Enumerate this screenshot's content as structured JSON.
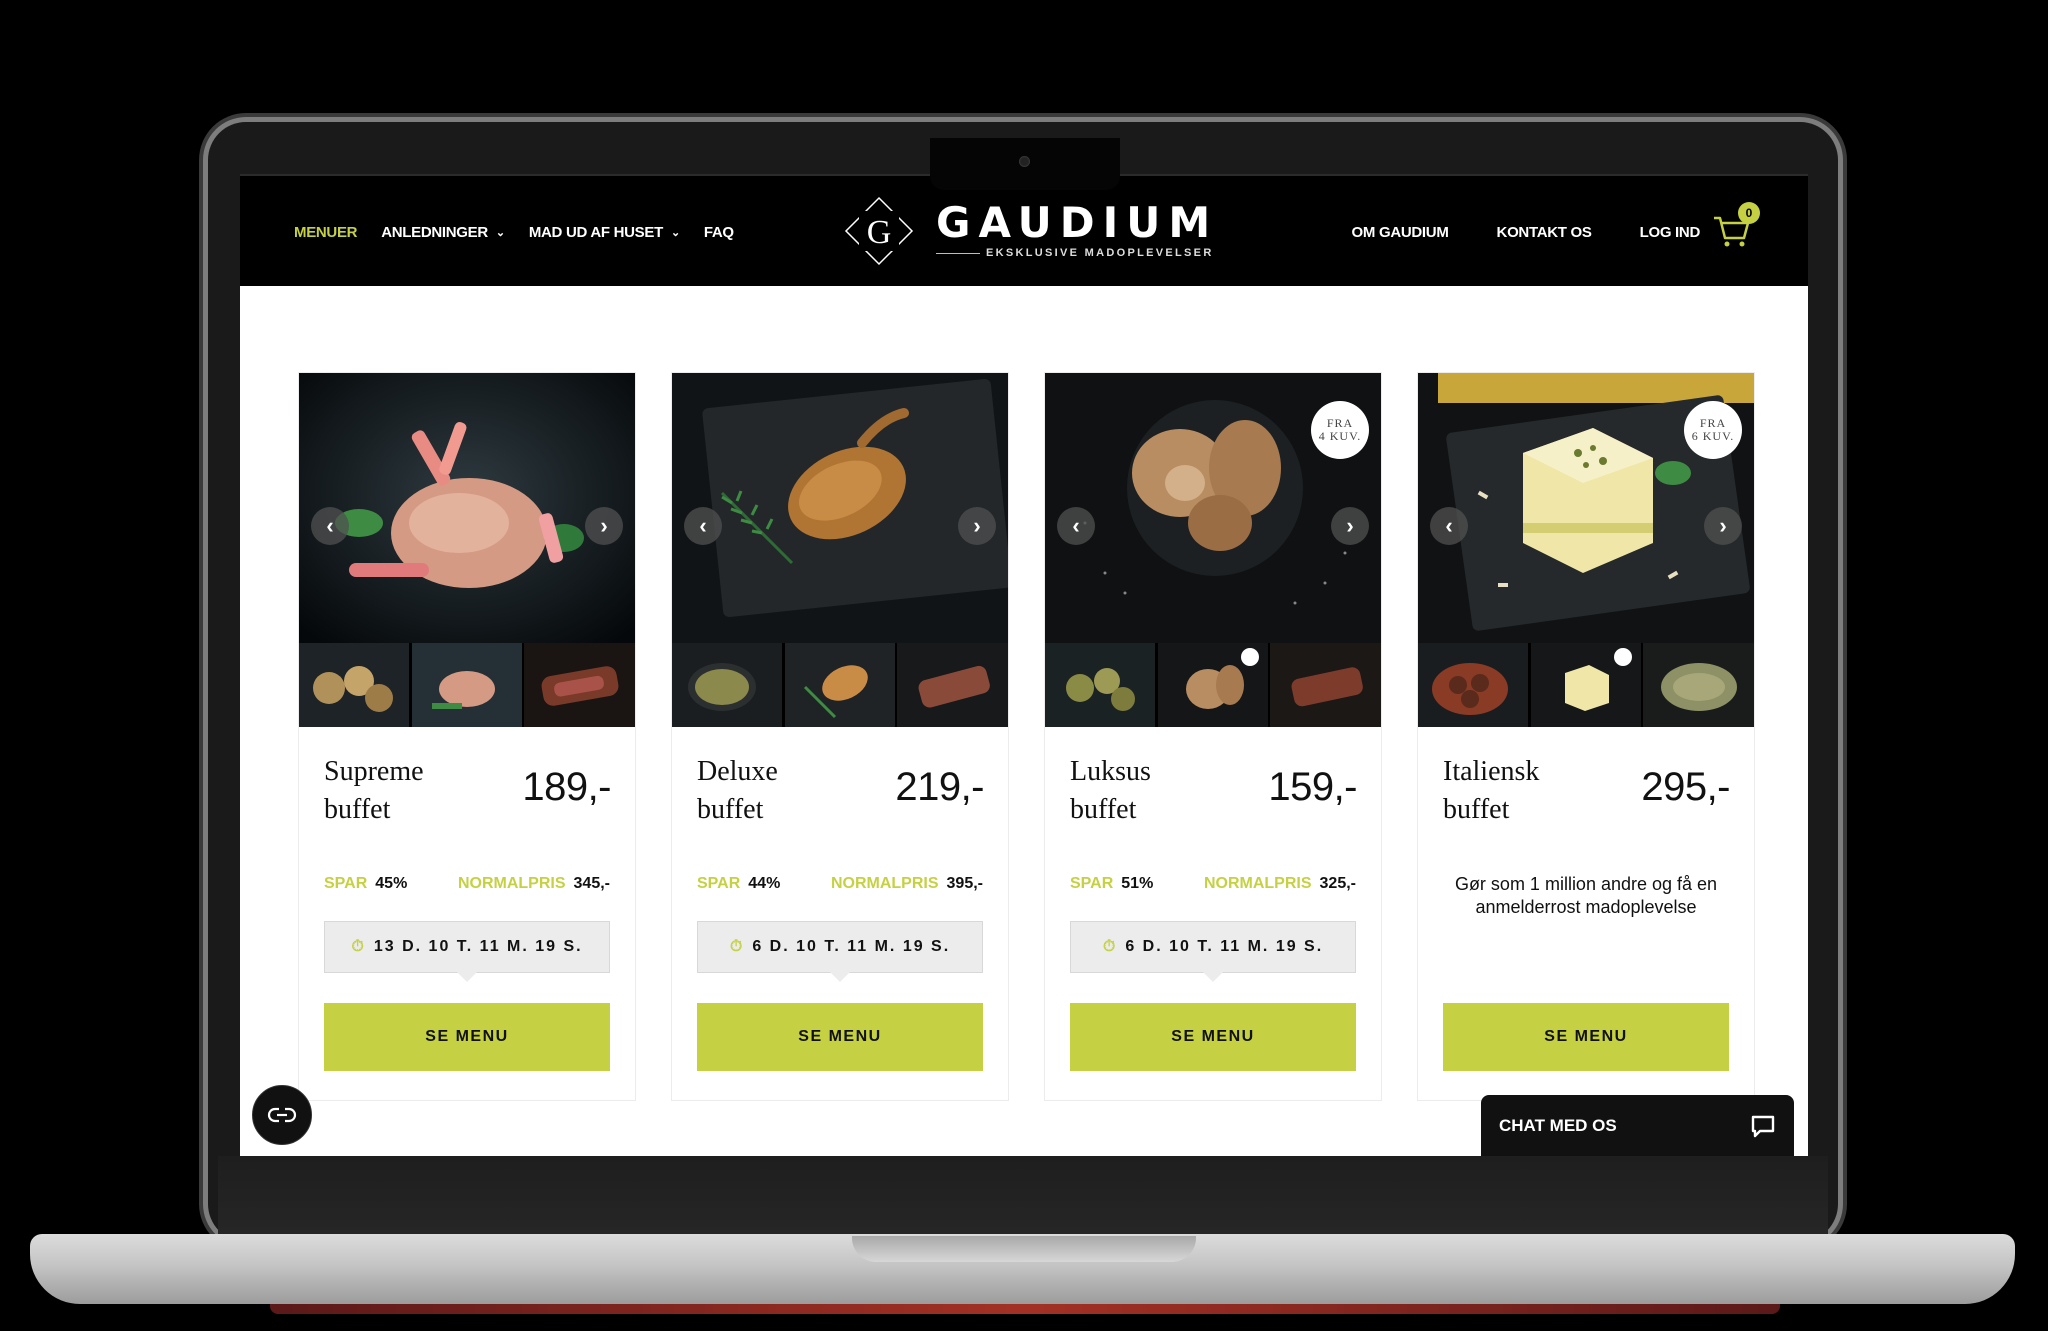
{
  "header": {
    "nav_left": [
      {
        "label": "MENUER",
        "active": true,
        "has_dropdown": false
      },
      {
        "label": "ANLEDNINGER",
        "active": false,
        "has_dropdown": true
      },
      {
        "label": "MAD UD AF HUSET",
        "active": false,
        "has_dropdown": true
      },
      {
        "label": "FAQ",
        "active": false,
        "has_dropdown": false
      }
    ],
    "logo": {
      "mark": "G",
      "name": "GAUDIUM",
      "tagline": "EKSKLUSIVE MADOPLEVELSER"
    },
    "nav_right": [
      {
        "label": "OM GAUDIUM"
      },
      {
        "label": "KONTAKT OS"
      },
      {
        "label": "LOG IND"
      }
    ],
    "cart_count": "0"
  },
  "cards": [
    {
      "name": "Supreme buffet",
      "price": "189,-",
      "save_label": "SPAR",
      "save_value": "45%",
      "normal_label": "NORMALPRIS",
      "normal_value": "345,-",
      "timer": "13 D. 10 T. 11 M. 19 S.",
      "cta": "SE MENU"
    },
    {
      "name": "Deluxe buffet",
      "price": "219,-",
      "save_label": "SPAR",
      "save_value": "44%",
      "normal_label": "NORMALPRIS",
      "normal_value": "395,-",
      "timer": "6 D. 10 T. 11 M. 19 S.",
      "cta": "SE MENU"
    },
    {
      "name": "Luksus buffet",
      "price": "159,-",
      "badge_line1": "FRA",
      "badge_line2": "4 KUV.",
      "save_label": "SPAR",
      "save_value": "51%",
      "normal_label": "NORMALPRIS",
      "normal_value": "325,-",
      "timer": "6 D. 10 T. 11 M. 19 S.",
      "cta": "SE MENU"
    },
    {
      "name": "Italiensk buffet",
      "price": "295,-",
      "badge_line1": "FRA",
      "badge_line2": "6 KUV.",
      "promo": "Gør som 1 million andre og få en anmelderrost madoplevelse",
      "cta": "SE MENU"
    }
  ],
  "chat": {
    "label": "CHAT MED OS"
  },
  "colors": {
    "accent": "#c5d143",
    "header_bg": "#000000",
    "text": "#111111"
  },
  "icons": [
    "chevron-down-icon",
    "cart-icon",
    "arrow-left-icon",
    "arrow-right-icon",
    "clock-icon",
    "chat-icon",
    "accessibility-icon"
  ]
}
